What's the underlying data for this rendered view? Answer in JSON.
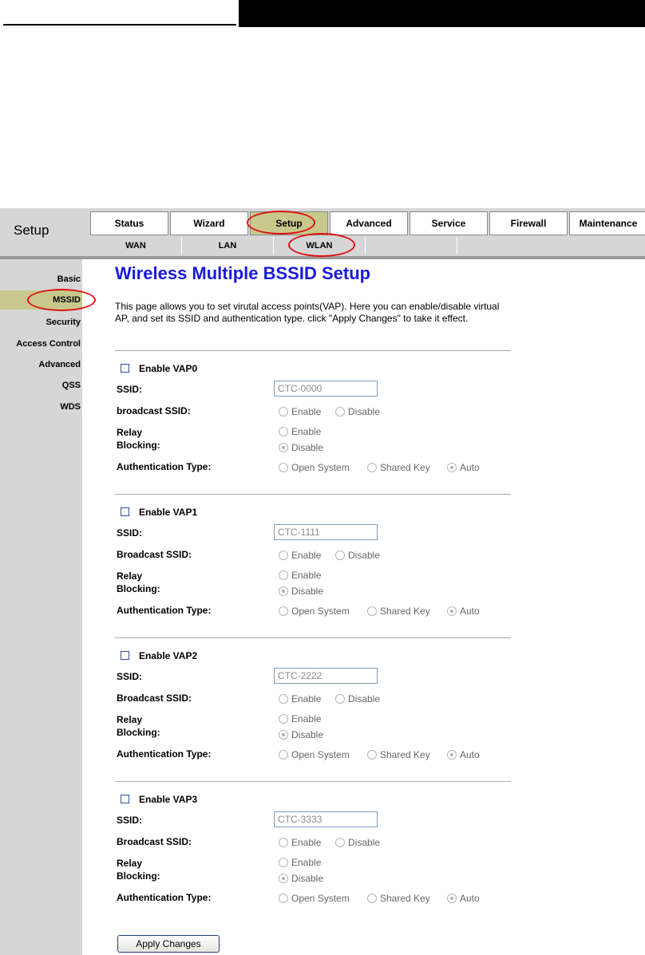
{
  "section_title": "Setup",
  "top_tabs": [
    "Status",
    "Wizard",
    "Setup",
    "Advanced",
    "Service",
    "Firewall",
    "Maintenance"
  ],
  "active_top_tab": "Setup",
  "sub_tabs": [
    "WAN",
    "LAN",
    "WLAN"
  ],
  "active_sub_tab": "WLAN",
  "menu": [
    "Basic",
    "MSSID",
    "Security",
    "Access Control",
    "Advanced",
    "QSS",
    "WDS"
  ],
  "active_menu": "MSSID",
  "page": {
    "title": "Wireless Multiple BSSID Setup",
    "description": "This page allows you to set virutal access points(VAP). Here you can enable/disable virtual AP, and set its SSID and authentication type. click \"Apply Changes\" to take it effect."
  },
  "vaps": [
    {
      "enable_label": "Enable VAP0",
      "enabled": false,
      "ssid_label": "SSID:",
      "ssid_value": "CTC-0000",
      "broadcast_label": "broadcast SSID:",
      "broadcast_options": [
        "Enable",
        "Disable"
      ],
      "broadcast_selected": null,
      "relay_label_1": "Relay",
      "relay_label_2": "Blocking:",
      "relay_options": [
        "Enable",
        "Disable"
      ],
      "relay_selected": "Disable",
      "auth_label": "Authentication Type:",
      "auth_options": [
        "Open System",
        "Shared Key",
        "Auto"
      ],
      "auth_selected": "Auto"
    },
    {
      "enable_label": "Enable VAP1",
      "enabled": false,
      "ssid_label": "SSID:",
      "ssid_value": "CTC-1111",
      "broadcast_label": "Broadcast SSID:",
      "broadcast_options": [
        "Enable",
        "Disable"
      ],
      "broadcast_selected": null,
      "relay_label_1": "Relay",
      "relay_label_2": "Blocking:",
      "relay_options": [
        "Enable",
        "Disable"
      ],
      "relay_selected": "Disable",
      "auth_label": "Authentication Type:",
      "auth_options": [
        "Open System",
        "Shared Key",
        "Auto"
      ],
      "auth_selected": "Auto"
    },
    {
      "enable_label": "Enable VAP2",
      "enabled": false,
      "ssid_label": "SSID:",
      "ssid_value": "CTC-2222",
      "broadcast_label": "Broadcast SSID:",
      "broadcast_options": [
        "Enable",
        "Disable"
      ],
      "broadcast_selected": null,
      "relay_label_1": "Relay",
      "relay_label_2": "Blocking:",
      "relay_options": [
        "Enable",
        "Disable"
      ],
      "relay_selected": "Disable",
      "auth_label": "Authentication Type:",
      "auth_options": [
        "Open System",
        "Shared Key",
        "Auto"
      ],
      "auth_selected": "Auto"
    },
    {
      "enable_label": "Enable VAP3",
      "enabled": false,
      "ssid_label": "SSID:",
      "ssid_value": "CTC-3333",
      "broadcast_label": "Broadcast SSID:",
      "broadcast_options": [
        "Enable",
        "Disable"
      ],
      "broadcast_selected": null,
      "relay_label_1": "Relay",
      "relay_label_2": "Blocking:",
      "relay_options": [
        "Enable",
        "Disable"
      ],
      "relay_selected": "Disable",
      "auth_label": "Authentication Type:",
      "auth_options": [
        "Open System",
        "Shared Key",
        "Auto"
      ],
      "auth_selected": "Auto"
    }
  ],
  "apply_label": "Apply Changes",
  "colors": {
    "title_blue": "#1a1adc",
    "active_tab": "#c8c88c",
    "frame_gray": "#d6d6d6",
    "highlight_ring": "#d11111"
  }
}
